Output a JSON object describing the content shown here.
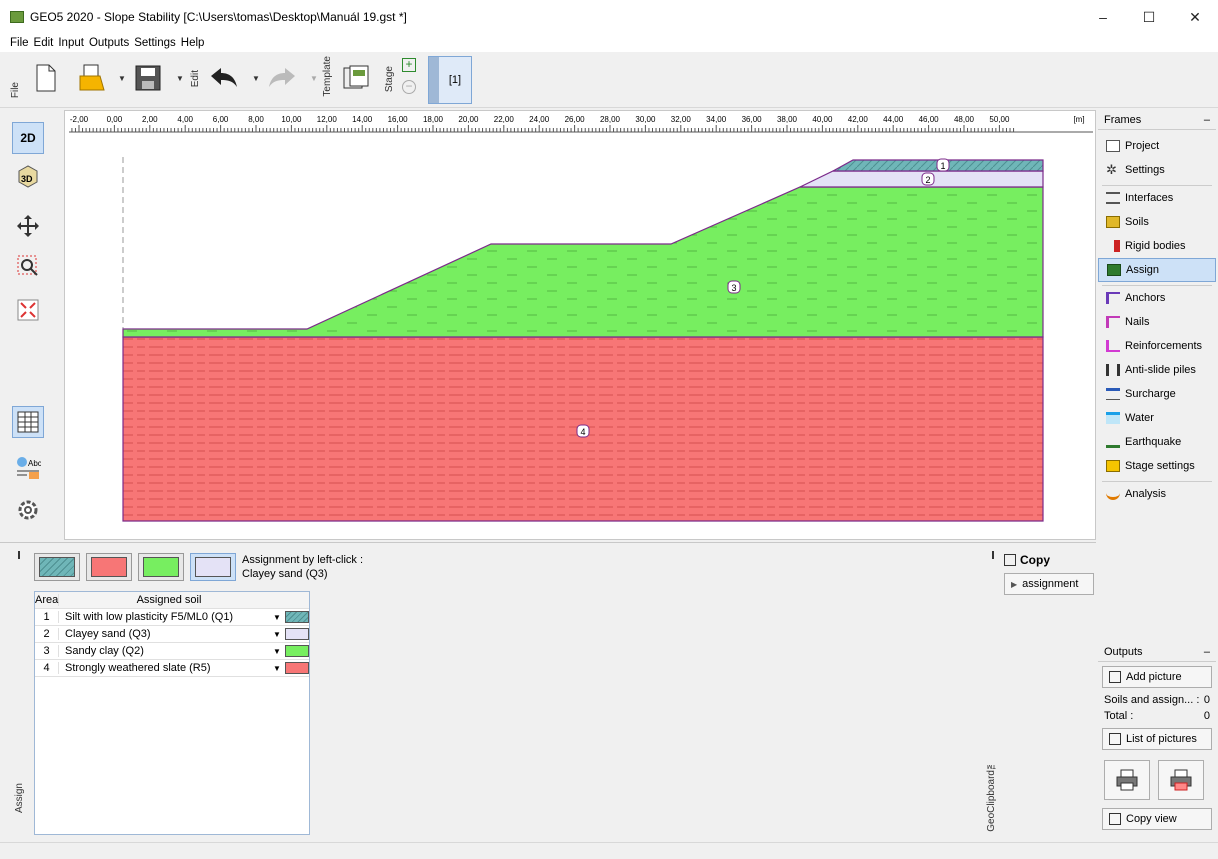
{
  "window": {
    "title": "GEO5 2020 - Slope Stability [C:\\Users\\tomas\\Desktop\\Manuál 19.gst *]",
    "minimize": "–",
    "maximize": "☐",
    "close": "✕"
  },
  "menu": [
    "File",
    "Edit",
    "Input",
    "Outputs",
    "Settings",
    "Help"
  ],
  "toolbar": {
    "file_label": "File",
    "edit_label": "Edit",
    "template_label": "Template",
    "stage_label": "Stage",
    "stage_current": "[1]"
  },
  "ruler": {
    "ticks": [
      "-2,00",
      "0,00",
      "2,00",
      "4,00",
      "6,00",
      "8,00",
      "10,00",
      "12,00",
      "14,00",
      "16,00",
      "18,00",
      "20,00",
      "22,00",
      "24,00",
      "26,00",
      "28,00",
      "30,00",
      "32,00",
      "34,00",
      "36,00",
      "38,00",
      "40,00",
      "42,00",
      "44,00",
      "46,00",
      "48,00",
      "50,00"
    ],
    "unit": "[m]"
  },
  "regions": [
    {
      "label": "1",
      "color": "#6fb6b8"
    },
    {
      "label": "2",
      "color": "#e4e2f6"
    },
    {
      "label": "3",
      "color": "#77ee60"
    },
    {
      "label": "4",
      "color": "#f77676"
    }
  ],
  "frames": {
    "header": "Frames",
    "items": [
      {
        "label": "Project",
        "icon": "document-icon"
      },
      {
        "label": "Settings",
        "icon": "gear-icon"
      },
      {
        "label": "Interfaces",
        "icon": "interfaces-icon"
      },
      {
        "label": "Soils",
        "icon": "soils-icon"
      },
      {
        "label": "Rigid bodies",
        "icon": "rigid-bodies-icon"
      },
      {
        "label": "Assign",
        "icon": "assign-icon"
      },
      {
        "label": "Anchors",
        "icon": "anchors-icon"
      },
      {
        "label": "Nails",
        "icon": "nails-icon"
      },
      {
        "label": "Reinforcements",
        "icon": "reinforcements-icon"
      },
      {
        "label": "Anti-slide piles",
        "icon": "piles-icon"
      },
      {
        "label": "Surcharge",
        "icon": "surcharge-icon"
      },
      {
        "label": "Water",
        "icon": "water-icon"
      },
      {
        "label": "Earthquake",
        "icon": "earthquake-icon"
      },
      {
        "label": "Stage settings",
        "icon": "stage-settings-icon"
      },
      {
        "label": "Analysis",
        "icon": "analysis-icon"
      }
    ]
  },
  "outputs": {
    "header": "Outputs",
    "add_picture": "Add picture",
    "soils_label": "Soils and assign... :",
    "soils_count": "0",
    "total_label": "Total :",
    "total_count": "0",
    "list_pictures": "List of pictures",
    "copy_view": "Copy view"
  },
  "assign": {
    "side_label": "Assign",
    "hint_line1": "Assignment by left-click :",
    "hint_line2": "Clayey sand (Q3)",
    "col_area": "Area",
    "col_soil": "Assigned soil",
    "rows": [
      {
        "area": "1",
        "soil": "Silt with low plasticity F5/ML0 (Q1)",
        "color": "#6fb6b8"
      },
      {
        "area": "2",
        "soil": "Clayey sand (Q3)",
        "color": "#e4e2f6"
      },
      {
        "area": "3",
        "soil": "Sandy clay (Q2)",
        "color": "#77ee60"
      },
      {
        "area": "4",
        "soil": "Strongly weathered slate (R5)",
        "color": "#f77676"
      }
    ]
  },
  "clipboard": {
    "copy": "Copy",
    "assignment": "assignment",
    "side_label": "GeoClipboard™"
  }
}
